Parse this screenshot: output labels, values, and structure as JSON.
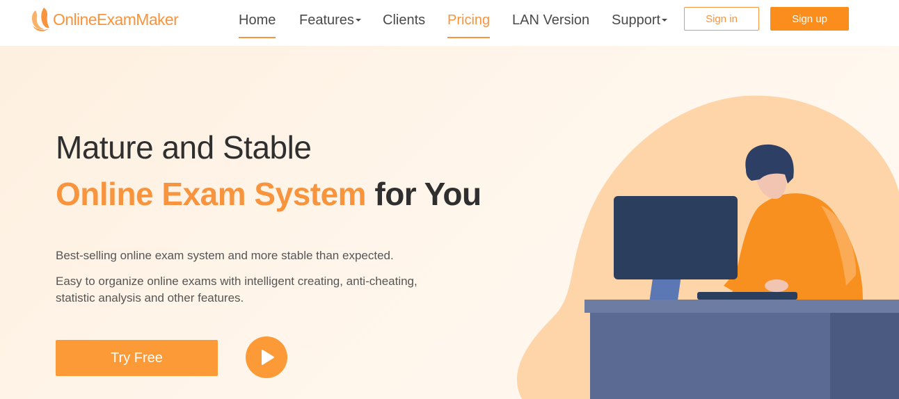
{
  "brand": {
    "name": "OnlineExamMaker",
    "color": "#f7943d"
  },
  "nav": {
    "home": "Home",
    "features": "Features",
    "clients": "Clients",
    "pricing": "Pricing",
    "lan": "LAN Version",
    "support": "Support",
    "active_item": "Pricing"
  },
  "auth": {
    "signin": "Sign in",
    "signup": "Sign up"
  },
  "hero": {
    "title_line1": "Mature and Stable",
    "title_accent": "Online Exam System",
    "title_suffix": " for You",
    "desc1": "Best-selling online exam system and more stable than expected.",
    "desc2": "Easy to organize online exams with intelligent creating, anti-cheating, statistic analysis and other features.",
    "cta": "Try Free",
    "play_icon": "play-icon"
  },
  "colors": {
    "accent": "#f7943d",
    "button": "#fb8d1d",
    "hero_bg": "#fff4e8",
    "monitor": "#2c3e5e",
    "desk": "#5a6a92"
  }
}
